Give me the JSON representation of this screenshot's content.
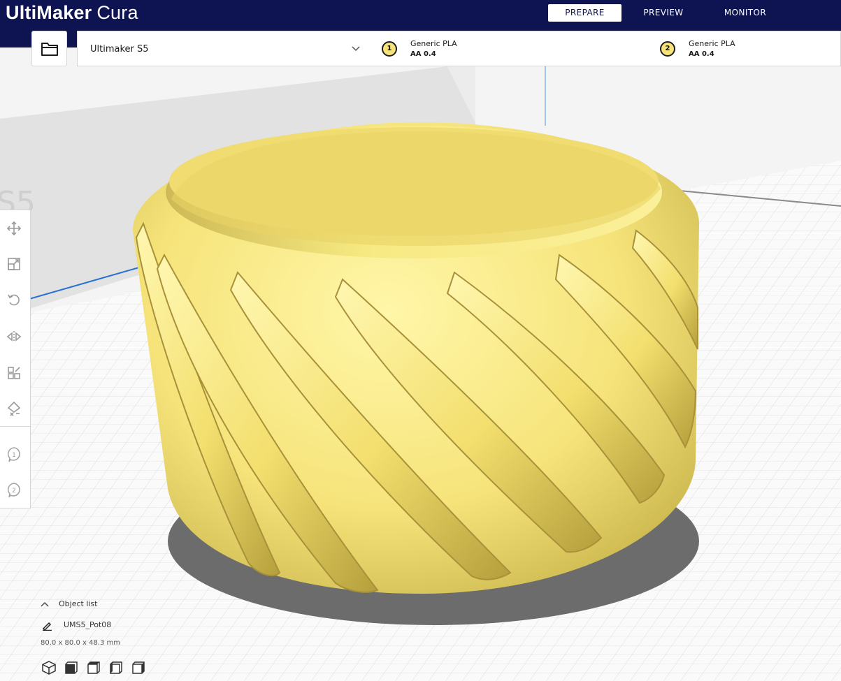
{
  "app": {
    "brand_bold": "UltiMaker",
    "brand_light": "Cura"
  },
  "stages": [
    {
      "label": "PREPARE",
      "active": true
    },
    {
      "label": "PREVIEW",
      "active": false
    },
    {
      "label": "MONITOR",
      "active": false
    }
  ],
  "printer": {
    "name": "Ultimaker S5"
  },
  "extruders": [
    {
      "number": "1",
      "material": "Generic PLA",
      "core": "AA 0.4"
    },
    {
      "number": "2",
      "material": "Generic PLA",
      "core": "AA 0.4"
    }
  ],
  "build_plate": {
    "label": "S5"
  },
  "object_list": {
    "header": "Object list",
    "object_name": "UMS5_Pot08",
    "dimensions": "80.0 x 80.0 x 48.3 mm"
  },
  "colors": {
    "header_bg": "#0e1452",
    "model_yellow": "#f6e47a",
    "grid_line": "#d3d3d3"
  },
  "icons": {
    "open": "folder-icon",
    "printer_dropdown": "chevron-down-icon",
    "tools": [
      "move-icon",
      "scale-icon",
      "rotate-icon",
      "mirror-icon",
      "per-model-settings-icon",
      "support-blocker-icon",
      "extruder-1-icon",
      "extruder-2-icon"
    ],
    "camera": [
      "3d-view-icon",
      "front-view-icon",
      "top-view-icon",
      "left-view-icon",
      "right-view-icon"
    ]
  }
}
